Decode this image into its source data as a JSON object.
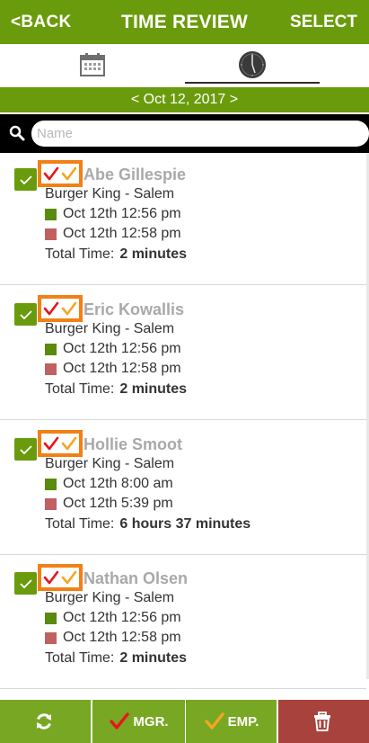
{
  "header": {
    "back_label": "<BACK",
    "title": "TIME REVIEW",
    "select_label": "SELECT"
  },
  "tabs": [
    {
      "icon": "calendar-icon"
    },
    {
      "icon": "clock-icon"
    }
  ],
  "date_nav": {
    "label": "< Oct 12, 2017 >"
  },
  "search": {
    "placeholder": "Name",
    "value": ""
  },
  "entries": [
    {
      "name": "Abe Gillespie",
      "location": "Burger King - Salem",
      "clock_in": "Oct 12th 12:56 pm",
      "clock_out": "Oct 12th 12:58 pm",
      "total_label": "Total Time:",
      "total_value": "2 minutes"
    },
    {
      "name": "Eric Kowallis",
      "location": "Burger King - Salem",
      "clock_in": "Oct 12th 12:56 pm",
      "clock_out": "Oct 12th 12:58 pm",
      "total_label": "Total Time:",
      "total_value": "2 minutes"
    },
    {
      "name": "Hollie Smoot",
      "location": "Burger King - Salem",
      "clock_in": "Oct 12th 8:00 am",
      "clock_out": "Oct 12th 5:39 pm",
      "total_label": "Total Time:",
      "total_value": "6 hours 37 minutes"
    },
    {
      "name": "Nathan Olsen",
      "location": "Burger King - Salem",
      "clock_in": "Oct 12th 12:56 pm",
      "clock_out": "Oct 12th 12:58 pm",
      "total_label": "Total Time:",
      "total_value": "2 minutes"
    }
  ],
  "footer": {
    "mgr_label": "MGR.",
    "emp_label": "EMP."
  },
  "colors": {
    "brand_green": "#6a9b0c",
    "mgr_check": "#e8141b",
    "emp_check": "#f5a623",
    "marks_border": "#f28016",
    "delete": "#a8423c"
  }
}
